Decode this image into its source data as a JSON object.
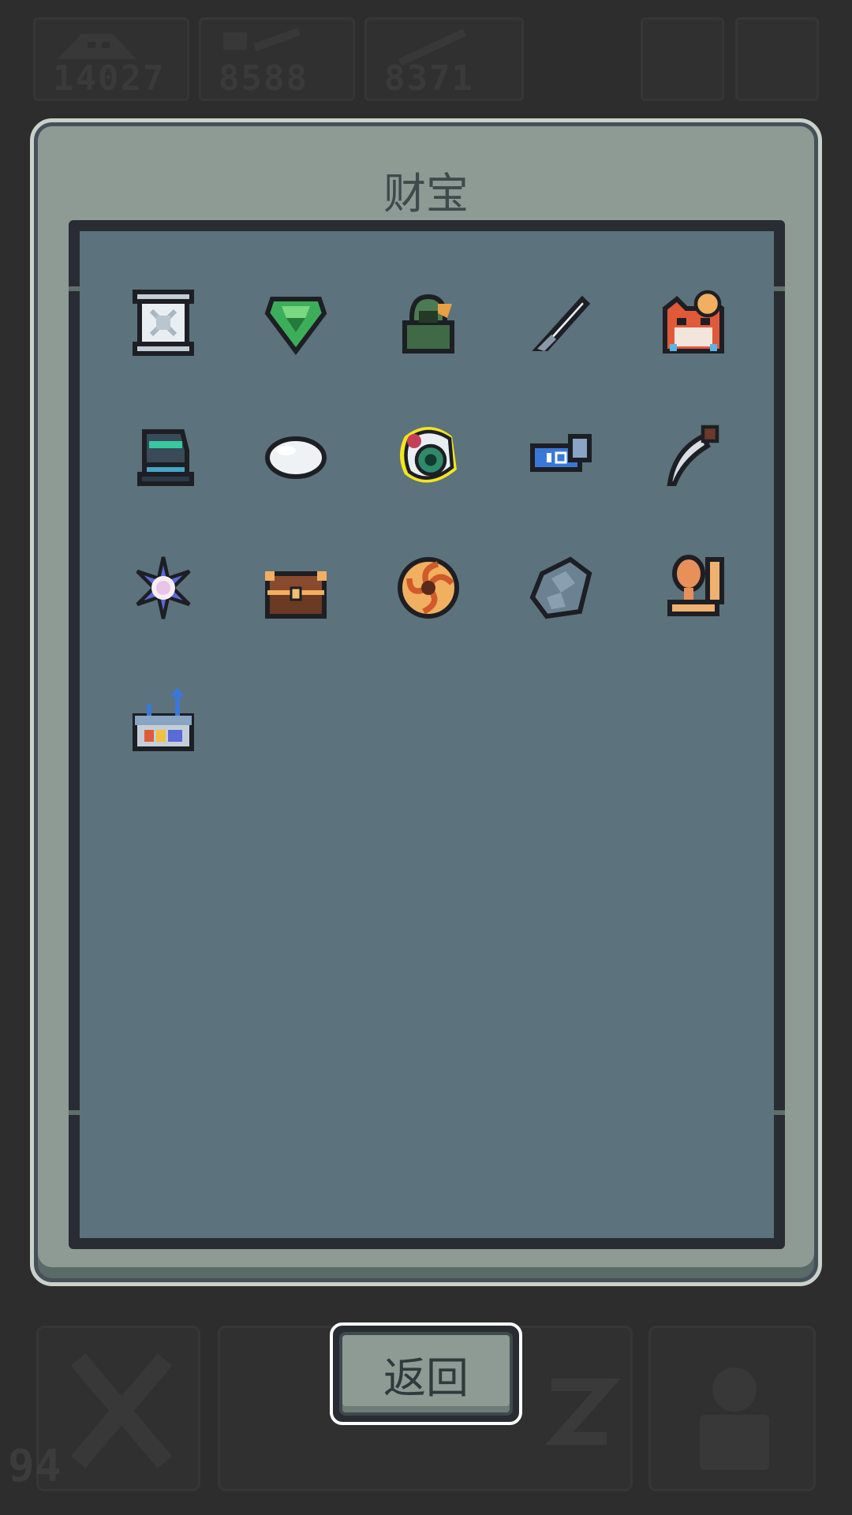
{
  "hud": {
    "resources": [
      {
        "name": "skull-resource",
        "value": "14027"
      },
      {
        "name": "hammer-resource",
        "value": "8588"
      },
      {
        "name": "sword-resource",
        "value": "8371"
      }
    ],
    "level": "94"
  },
  "panel": {
    "title": "财宝"
  },
  "treasures": [
    {
      "icon": "scroll-icon"
    },
    {
      "icon": "green-gem-icon"
    },
    {
      "icon": "hooded-figure-icon"
    },
    {
      "icon": "knife-icon"
    },
    {
      "icon": "fox-mask-icon"
    },
    {
      "icon": "gauntlet-icon"
    },
    {
      "icon": "white-pearl-icon"
    },
    {
      "icon": "eyeball-icon",
      "selected": true
    },
    {
      "icon": "ticket-icon"
    },
    {
      "icon": "dagger-icon"
    },
    {
      "icon": "crystal-flower-icon"
    },
    {
      "icon": "treasure-chest-icon"
    },
    {
      "icon": "spiral-orb-icon"
    },
    {
      "icon": "stone-icon"
    },
    {
      "icon": "trophy-icon"
    },
    {
      "icon": "device-box-icon"
    }
  ],
  "buttons": {
    "back_label": "返回"
  },
  "colors": {
    "panel": "#8e9b95",
    "inner": "#5c727c",
    "selected_outline": "#f5e51e"
  }
}
